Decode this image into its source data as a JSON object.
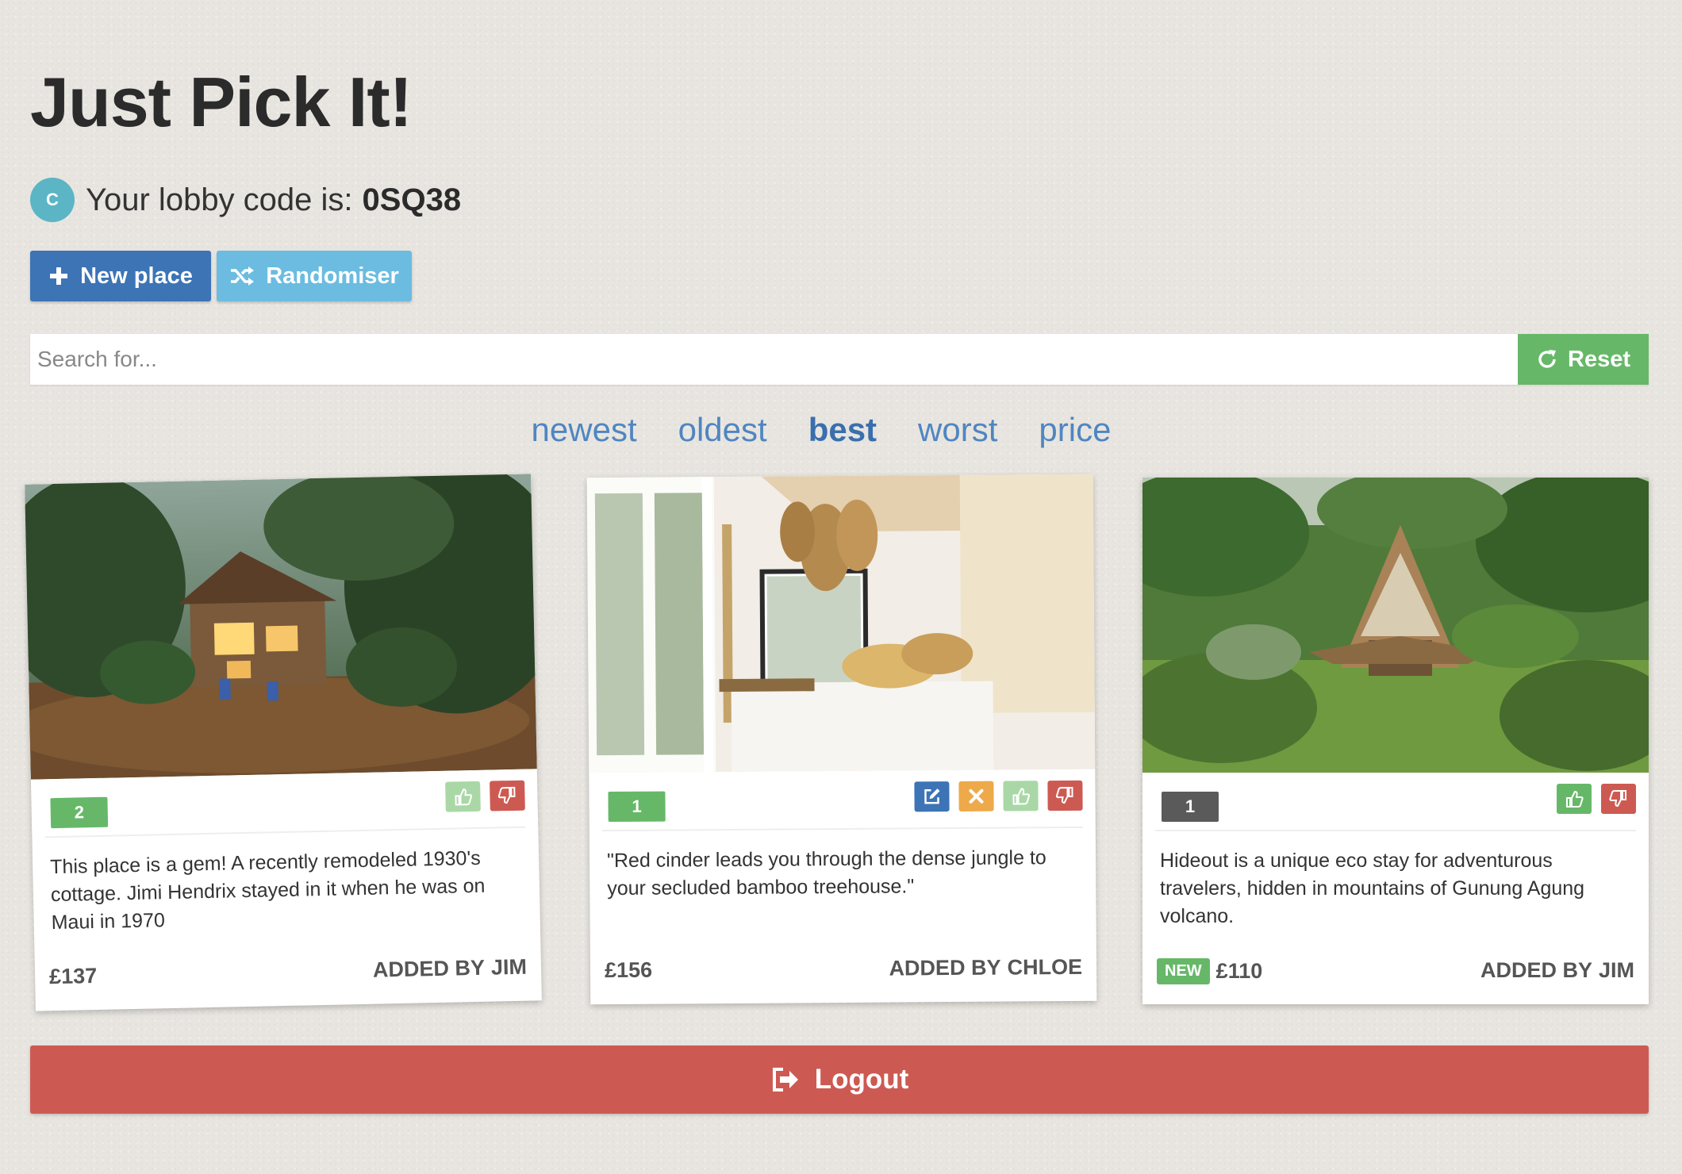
{
  "header": {
    "title": "Just Pick It!"
  },
  "lobby": {
    "avatar_initial": "C",
    "label": "Your lobby code is:",
    "code": "0SQ38"
  },
  "toolbar": {
    "new_place_label": "New place",
    "randomiser_label": "Randomiser"
  },
  "search": {
    "placeholder": "Search for...",
    "value": "",
    "reset_label": "Reset"
  },
  "sort": {
    "options": [
      "newest",
      "oldest",
      "best",
      "worst",
      "price"
    ],
    "active": "best"
  },
  "cards": [
    {
      "score": "2",
      "score_color": "#66b868",
      "description": "This place is a gem! A recently remodeled 1930's cottage. Jimi Hendrix stayed in it when he was on Maui in 1970",
      "price": "£137",
      "badge": "",
      "added_by_prefix": "ADDED BY",
      "added_by": "JIM",
      "actions": [
        "thumbs-up-icon",
        "thumbs-down-icon"
      ],
      "image": "forest-cottage-at-dusk"
    },
    {
      "score": "1",
      "score_color": "#66b868",
      "description": "\"Red cinder leads you through the dense jungle to your secluded bamboo treehouse.\"",
      "price": "£156",
      "badge": "",
      "added_by_prefix": "ADDED BY",
      "added_by": "CHLOE",
      "actions": [
        "edit-icon",
        "delete-icon",
        "thumbs-up-icon",
        "thumbs-down-icon"
      ],
      "image": "bamboo-treehouse-bedroom"
    },
    {
      "score": "1",
      "score_color": "#5a5a5a",
      "description": "Hideout is a unique eco stay for adventurous travelers, hidden in mountains of Gunung Agung volcano.",
      "price": "£110",
      "badge": "NEW",
      "added_by_prefix": "ADDED BY",
      "added_by": "JIM",
      "actions": [
        "thumbs-up-icon",
        "thumbs-down-icon"
      ],
      "image": "bamboo-a-frame-in-jungle"
    }
  ],
  "footer": {
    "logout_label": "Logout"
  },
  "colors": {
    "primary": "#3c74b6",
    "info": "#6bbce0",
    "success": "#66b868",
    "danger": "#cd5a52",
    "warning": "#eea94a",
    "edit": "#3c74b6",
    "thumb_up_faded": "#a9d8a6",
    "dark_badge": "#5a5a5a"
  }
}
